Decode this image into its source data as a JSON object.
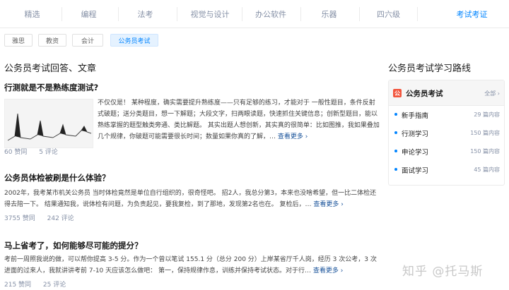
{
  "topnav": {
    "tabs": [
      {
        "label": "精选"
      },
      {
        "label": "编程"
      },
      {
        "label": "法考"
      },
      {
        "label": "视觉与设计"
      },
      {
        "label": "办公软件"
      },
      {
        "label": "乐器"
      },
      {
        "label": "四六级"
      },
      {
        "label": "考试考证"
      }
    ],
    "active_index": 7
  },
  "chips": [
    {
      "label": "雅思"
    },
    {
      "label": "教资"
    },
    {
      "label": "会计"
    },
    {
      "label": "公务员考试"
    }
  ],
  "main": {
    "section_title": "公务员考试回答、文章",
    "questions": [
      {
        "title": "行测就是不是熟练度测试?",
        "text": "不仅仅是！ 某种程度，确实需要提升熟练度——只有足够的练习，才能对于 一般性题目，条件反射式破题；送分类题目，想一下解题；大段文字，扫两眼读题，快速抓住关键信息；创新型题目，能以熟练掌握的题型触类旁通、类比解题。 其实出题人想创新，其实真的很简单：比如图推，我如果叠加几个规律，你破题可能需要很长时间；数量如果你真的了解，…",
        "more": "查看更多 ›",
        "likes": "60 赞同",
        "comments": "5 评论"
      },
      {
        "title": "公务员体检被刷是什么体验？",
        "text": "2002年，我考某市机关公务员 当时体检竟然是单位自行组织的，很奇怪吧。 招2人，我总分第3，本来也没啥希望，但一比二体检还得去陪一下。 结果通知我，说体检有问题，为负责起见，要我复检，到了那地，发现第2名也在。 复检后，…",
        "more": "查看更多 ›",
        "likes": "3755 赞同",
        "comments": "242 评论"
      },
      {
        "title": "马上省考了，如何能够尽可能的提分？",
        "text": "考前一周照我说的做，可以帮你提高 3-5 分。作为一个曾以笔试 155.1 分（总分 200 分）上岸某省厅千人岗，经历 3 次公考，3 次进面的过来人，我就讲讲考前 7-10 天应该怎么做吧： 第一，保持规律作息，训练并保持考试状态。对于行…",
        "more": "查看更多 ›",
        "likes": "215 赞同",
        "comments": "25 评论"
      }
    ]
  },
  "sidebar": {
    "title": "公务员考试学习路线",
    "box": {
      "logo_glyph": "公",
      "name": "公务员考试",
      "all_label": "全部 ›",
      "items": [
        {
          "label": "新手指南",
          "count": "29 篇内容"
        },
        {
          "label": "行测学习",
          "count": "150 篇内容"
        },
        {
          "label": "申论学习",
          "count": "150 篇内容"
        },
        {
          "label": "面试学习",
          "count": "45 篇内容"
        }
      ]
    }
  },
  "watermark": "知乎 @托马斯",
  "colors": {
    "accent": "#0084ff",
    "muted": "#8590a6",
    "logo": "#f2553d"
  }
}
